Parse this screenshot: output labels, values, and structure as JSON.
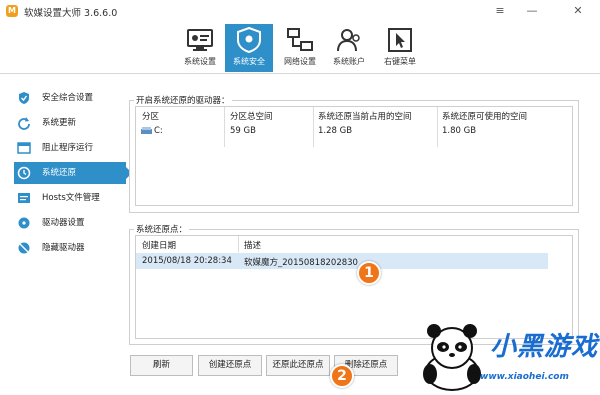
{
  "window": {
    "title": "软媒设置大师 3.6.6.0",
    "app_icon": "M",
    "controls": {
      "skin": "≡",
      "minimize": "—",
      "close": "✕"
    }
  },
  "toolbar": {
    "items": [
      {
        "label": "系统设置",
        "icon": "monitor-settings-icon"
      },
      {
        "label": "系统安全",
        "icon": "shield-icon",
        "active": true
      },
      {
        "label": "网络设置",
        "icon": "network-icon"
      },
      {
        "label": "系统账户",
        "icon": "users-icon"
      },
      {
        "label": "右键菜单",
        "icon": "cursor-icon"
      }
    ]
  },
  "sidebar": {
    "items": [
      {
        "label": "安全综合设置",
        "icon": "shield-check-icon"
      },
      {
        "label": "系统更新",
        "icon": "refresh-icon"
      },
      {
        "label": "阻止程序运行",
        "icon": "block-window-icon"
      },
      {
        "label": "系统还原",
        "icon": "restore-clock-icon",
        "active": true
      },
      {
        "label": "Hosts文件管理",
        "icon": "hosts-file-icon"
      },
      {
        "label": "驱动器设置",
        "icon": "drive-icon"
      },
      {
        "label": "隐藏驱动器",
        "icon": "hidden-drive-icon"
      }
    ]
  },
  "drives_group": {
    "title": "开启系统还原的驱动器：",
    "columns": [
      "分区",
      "分区总空间",
      "系统还原当前占用的空间",
      "系统还原可使用的空间"
    ],
    "rows": [
      {
        "partition": "C:",
        "total": "59 GB",
        "used": "1.28 GB",
        "available": "1.80 GB"
      }
    ]
  },
  "restore_group": {
    "title": "系统还原点：",
    "columns": [
      "创建日期",
      "描述"
    ],
    "rows": [
      {
        "date": "2015/08/18 20:28:34",
        "description": "软媒魔方_20150818202830"
      }
    ]
  },
  "buttons": {
    "refresh": "刷新",
    "create": "创建还原点",
    "restore": "还原此还原点",
    "delete": "删除还原点"
  },
  "callouts": {
    "one": "1",
    "two": "2"
  },
  "watermark": {
    "logo": "小黑游戏",
    "url": "www.xiaohei.com"
  },
  "colors": {
    "accent": "#2f8fc9",
    "selection": "#d9e8f7",
    "callout": "#f07418"
  }
}
